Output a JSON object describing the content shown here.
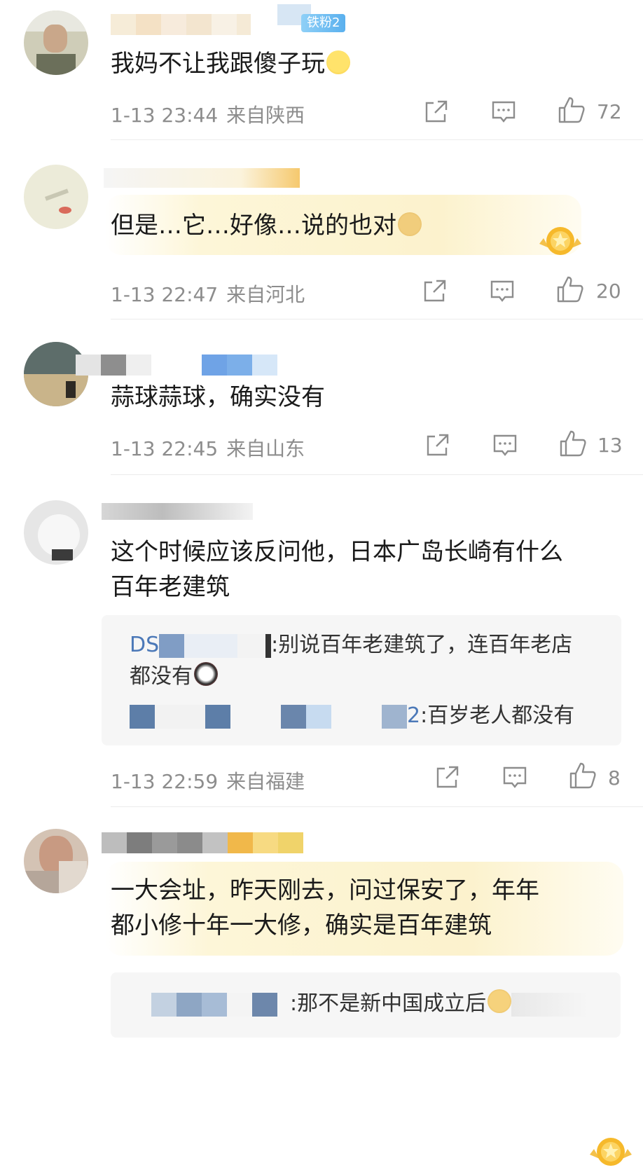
{
  "comments": [
    {
      "fan_badge": "铁粉2",
      "text": "我妈不让我跟傻子玩",
      "emoji": "smile-emoji",
      "time": "1-13 23:44",
      "location": "来自陕西",
      "likes": "72"
    },
    {
      "text": "但是…它…好像…说的也对",
      "emoji": "doge-emoji",
      "time": "1-13 22:47",
      "location": "来自河北",
      "likes": "20"
    },
    {
      "text": "蒜球蒜球，确实没有",
      "time": "1-13 22:45",
      "location": "来自山东",
      "likes": "13"
    },
    {
      "text_line1": "这个时候应该反问他，日本广岛长崎有什么",
      "text_line2": "百年老建筑",
      "replies": [
        {
          "name_prefix": "DS",
          "text_line1": ":别说百年老建筑了，连百年老店",
          "text_line2": "都没有"
        },
        {
          "name_suffix": "2",
          "text": ":百岁老人都没有"
        }
      ],
      "time": "1-13 22:59",
      "location": "来自福建",
      "likes": "8"
    },
    {
      "text_line1": "一大会址，昨天刚去，问过保安了，年年",
      "text_line2": "都小修十年一大修，确实是百年建筑",
      "replies": [
        {
          "text": ":那不是新中国成立后"
        }
      ]
    }
  ],
  "icons": {
    "share": "share-icon",
    "reply": "comment-icon",
    "like": "thumb-up-icon",
    "medal": "gold-medal-icon"
  },
  "colors": {
    "meta": "#8d8d8d",
    "reply_name": "#4c79b8",
    "highlight": "#fcf2cd",
    "divider": "#ececec"
  }
}
